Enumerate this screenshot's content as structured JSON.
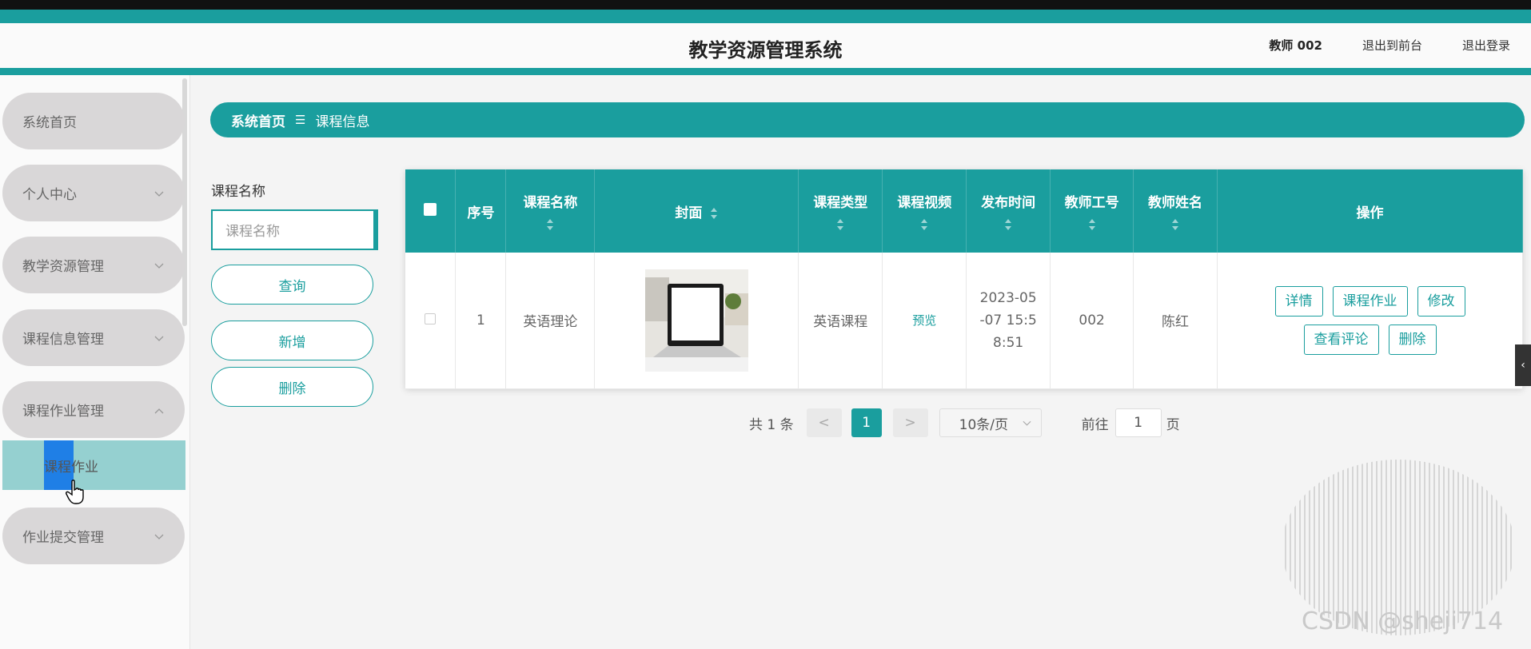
{
  "header": {
    "title": "教学资源管理系统",
    "user": "教师 002",
    "links": [
      "退出到前台",
      "退出登录"
    ]
  },
  "sidebar": {
    "items": [
      {
        "label": "系统首页",
        "has_chevron": false
      },
      {
        "label": "个人中心",
        "has_chevron": true
      },
      {
        "label": "教学资源管理",
        "has_chevron": true
      },
      {
        "label": "课程信息管理",
        "has_chevron": true
      },
      {
        "label": "课程作业管理",
        "has_chevron": true,
        "expanded": true
      },
      {
        "label": "作业提交管理",
        "has_chevron": true
      }
    ],
    "submenu": {
      "label": "课程作业"
    }
  },
  "breadcrumb": {
    "home": "系统首页",
    "separator": "☰",
    "current": "课程信息"
  },
  "search": {
    "label": "课程名称",
    "placeholder": "课程名称",
    "buttons": [
      "查询",
      "新增",
      "删除"
    ]
  },
  "table": {
    "headers": [
      "序号",
      "课程名称",
      "封面",
      "课程类型",
      "课程视频",
      "发布时间",
      "教师工号",
      "教师姓名",
      "操作"
    ],
    "rows": [
      {
        "index": "1",
        "course_name": "英语理论",
        "course_type": "英语课程",
        "video": "预览",
        "publish_line1": "2023-05",
        "publish_line2": "-07 15:5",
        "publish_line3": "8:51",
        "teacher_id": "002",
        "teacher_name": "陈红",
        "actions": [
          "详情",
          "课程作业",
          "修改",
          "查看评论",
          "删除"
        ]
      }
    ]
  },
  "pagination": {
    "total": "共 1 条",
    "prev": "<",
    "current_page": "1",
    "next": ">",
    "page_size": "10条/页",
    "goto_label": "前往",
    "goto_value": "1",
    "goto_suffix": "页"
  },
  "watermark": "CSDN @sheji714",
  "colors": {
    "accent": "#1a9e9e",
    "menu_bg": "#d9d7d8",
    "submenu_bg": "#95d0d0",
    "highlight": "#1f7fe6"
  }
}
